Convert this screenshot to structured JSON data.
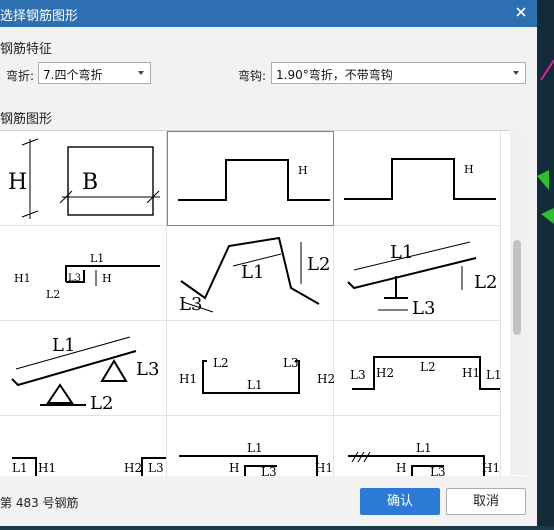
{
  "title": "选择钢筋图形",
  "feature_section": "钢筋特征",
  "bend_label": "弯折:",
  "bend_value": "7.四个弯折",
  "hook_label": "弯钩:",
  "hook_value": "1.90°弯折，不带弯钩",
  "shape_section": "钢筋图形",
  "footer_text": "第 483 号钢筋",
  "confirm_label": "确认",
  "cancel_label": "取消",
  "cells": {
    "c1": {
      "H": "H",
      "B": "B"
    },
    "c2": {
      "H": "H"
    },
    "c3": {
      "H": "H"
    },
    "c4": {
      "H1": "H1",
      "L1": "L1",
      "L2": "L2",
      "L3": "L3",
      "H": "H"
    },
    "c5": {
      "L1": "L1",
      "L2": "L2",
      "L3": "L3"
    },
    "c6": {
      "L1": "L1",
      "L2": "L2",
      "L3": "L3"
    },
    "c7": {
      "L1": "L1",
      "L2": "L2",
      "L3": "L3"
    },
    "c8": {
      "H1": "H1",
      "L2": "L2",
      "L3": "L3",
      "L1": "L1",
      "H2": "H2"
    },
    "c9": {
      "L3": "L3",
      "H2": "H2",
      "L2": "L2",
      "H1": "H1",
      "L1": "L1"
    },
    "c10": {
      "L1": "L1",
      "H1": "H1",
      "H2": "H2",
      "L3": "L3"
    },
    "c11": {
      "L1": "L1",
      "H": "H",
      "L3": "L3",
      "H1": "H1"
    },
    "c12": {
      "L1": "L1",
      "H": "H",
      "L3": "L3",
      "H1": "H1"
    }
  }
}
